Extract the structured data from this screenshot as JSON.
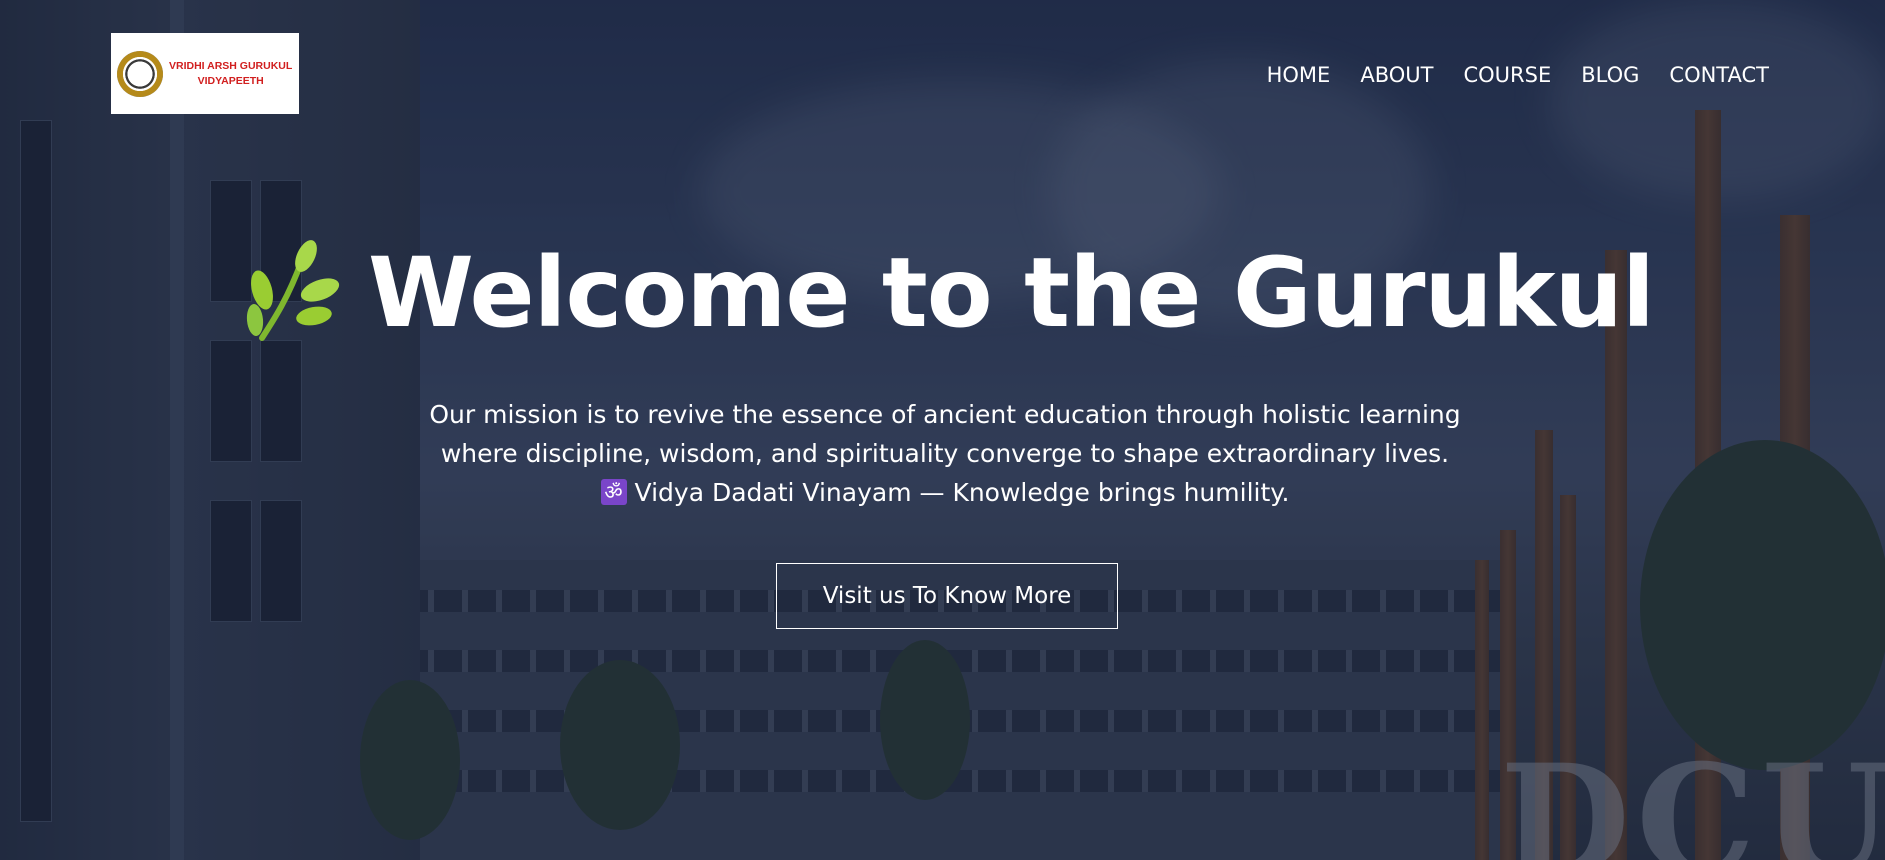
{
  "brand": {
    "logo_line1": "VRIDHI ARSH GURUKUL",
    "logo_line2": "VIDYAPEETH",
    "logo_color": "#d11f1f"
  },
  "nav": {
    "items": [
      {
        "label": "HOME"
      },
      {
        "label": "ABOUT"
      },
      {
        "label": "COURSE"
      },
      {
        "label": "BLOG"
      },
      {
        "label": "CONTACT"
      }
    ]
  },
  "hero": {
    "title": "Welcome to the Gurukul",
    "mission_line1": "Our mission is to revive the essence of ancient education through holistic learning",
    "mission_line2": "where discipline, wisdom, and spirituality converge to shape extraordinary lives.",
    "om_symbol": "ॐ",
    "motto": "Vidya Dadati Vinayam — Knowledge brings humility.",
    "cta_label": "Visit us To Know More",
    "icon": "herb-leaf-icon",
    "background_text": "DCU"
  },
  "colors": {
    "overlay": "#1e2a45",
    "text": "#ffffff",
    "leaf": "#9acd32",
    "om_badge": "#7a45c9"
  }
}
